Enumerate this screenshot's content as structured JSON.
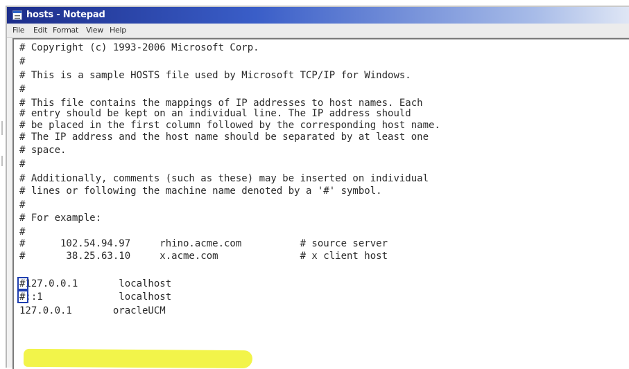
{
  "window": {
    "title": "hosts - Notepad"
  },
  "menu": [
    "File",
    "Edit",
    "Format",
    "View",
    "Help"
  ],
  "lines": [
    "# Copyright (c) 1993-2006 Microsoft Corp.",
    "#",
    "# This is a sample HOSTS file used by Microsoft TCP/IP for Windows.",
    "#",
    "# This file contains the mappings of IP addresses to host names. Each",
    "# entry should be kept on an individual line. The IP address should",
    "# be placed in the first column followed by the corresponding host name.",
    "# The IP address and the host name should be separated by at least one",
    "# space.",
    "#",
    "# Additionally, comments (such as these) may be inserted on individual",
    "# lines or following the machine name denoted by a '#' symbol.",
    "#",
    "# For example:",
    "#",
    "#      102.54.94.97     rhino.acme.com          # source server",
    "#       38.25.63.10     x.acme.com              # x client host",
    "",
    "#127.0.0.1       localhost",
    "#::1             localhost",
    "127.0.0.1       oracleUCM"
  ]
}
